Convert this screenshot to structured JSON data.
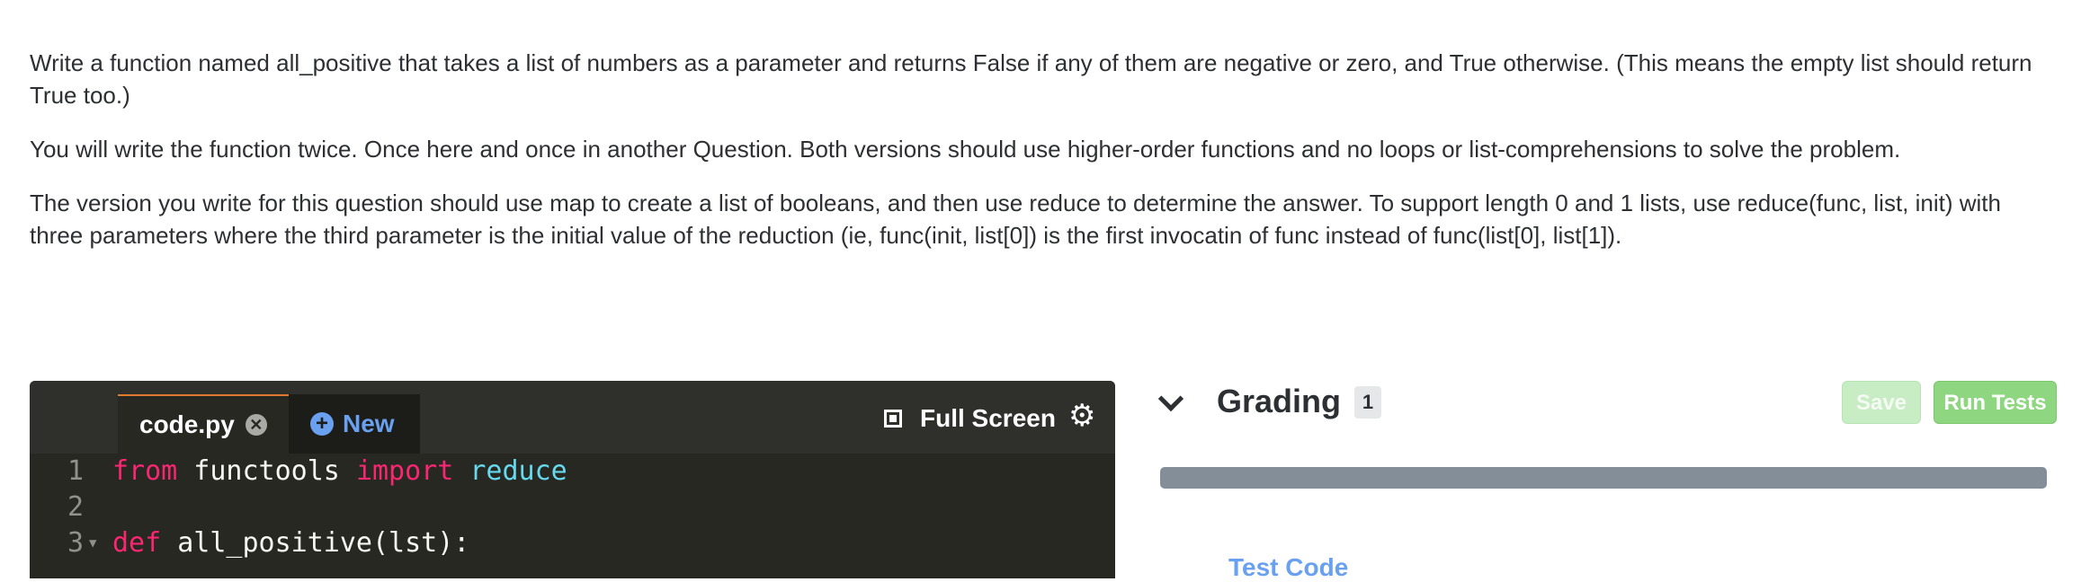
{
  "prompt": {
    "p1": "Write a function named all_positive that takes a list of numbers as a parameter and returns False if any of them are negative or zero, and True otherwise. (This means the empty list should return True too.)",
    "p2": "You will write the function twice. Once here and once in another Question. Both versions should use higher-order functions and no loops or list-comprehensions to solve the problem.",
    "p3": "The version you write for this question should use map to create a list of booleans, and then use reduce to determine the answer. To support length 0 and 1 lists, use reduce(func, list, init) with three parameters where the third parameter is the initial value of the reduction (ie, func(init, list[0]) is the first invocatin of func instead of func(list[0], list[1])."
  },
  "editor": {
    "tabs": {
      "code_label": "code.py",
      "close_glyph": "✕",
      "new_label": "New",
      "new_glyph": "+"
    },
    "fullscreen_label": "Full Screen",
    "settings_glyph": "⚙",
    "lines": [
      {
        "n": "1",
        "kw1": "from",
        "mid": " functools ",
        "kw2": "import",
        "bi": " reduce"
      },
      {
        "n": "2"
      },
      {
        "n": "3",
        "kw1": "def",
        "rest": " all_positive(lst):"
      }
    ]
  },
  "grading": {
    "title": "Grading",
    "count": "1",
    "save_label": "Save",
    "run_label": "Run Tests",
    "partial_text": "Test Code"
  },
  "colors": {
    "accent_blue": "#6aa0f0",
    "run_green": "#8fd681",
    "save_green_disabled": "#c8edc4",
    "editor_bg": "#272822",
    "keyword_pink": "#f92672",
    "builtin_cyan": "#66d9ef"
  },
  "icons": {
    "chevron": "chevron-down-icon",
    "close": "close-circle-icon",
    "new": "plus-circle-icon",
    "fullscreen": "fullscreen-icon",
    "settings": "gear-icon"
  }
}
